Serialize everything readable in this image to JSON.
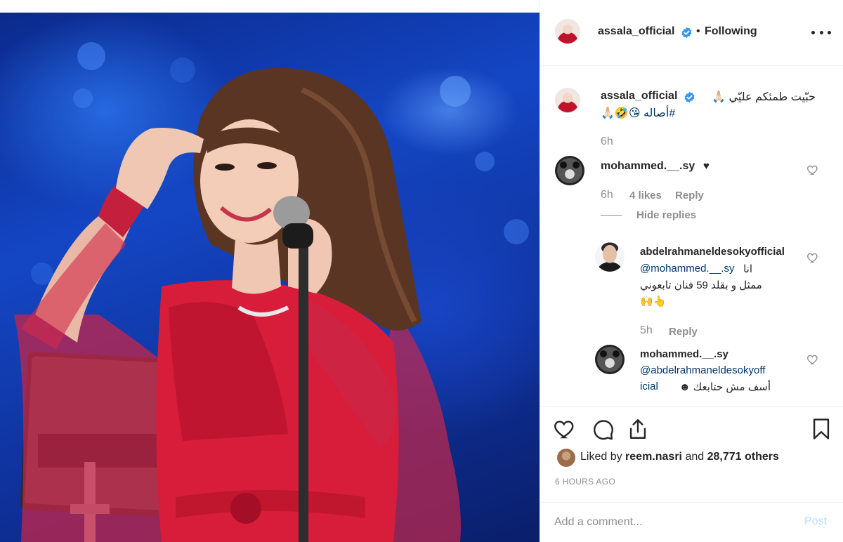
{
  "post": {
    "username": "assala_official",
    "separator": "•",
    "follow_status": "Following",
    "more_icon": "more-horizontal-icon",
    "verified_icon": "verified-badge-icon"
  },
  "caption": {
    "username": "assala_official",
    "text": "حبّيت طمئكم عليّي 🙏🏻",
    "hashtag": "#أصاله 😘🤣🙏🏻",
    "time": "6h"
  },
  "comments": [
    {
      "username": "mohammed.__.sy",
      "text": "♥",
      "time": "6h",
      "likes": "4 likes",
      "reply_label": "Reply",
      "hide_replies_label": "Hide replies",
      "replies": [
        {
          "username": "abdelrahmaneldesokyofficial",
          "mention": "@mohammed.__.sy",
          "line1": "انا",
          "line2": "ممثل و بقلد 59 فنان تابعوني",
          "line3": "🙌👆",
          "time": "5h",
          "reply_label": "Reply"
        },
        {
          "username": "mohammed.__.sy",
          "mention_part1": "@abdelrahmaneldesokyoff",
          "mention_part2": "icial",
          "text": "أسف مش حتابعك ☻"
        }
      ]
    }
  ],
  "actions": {
    "like_icon": "heart-icon",
    "comment_icon": "comment-icon",
    "share_icon": "share-icon",
    "save_icon": "bookmark-icon"
  },
  "likes": {
    "prefix": "Liked by",
    "user": "reem.nasri",
    "middle": "and",
    "others": "28,771 others"
  },
  "time_ago": "6 HOURS AGO",
  "add_comment": {
    "placeholder": "Add a comment...",
    "post_label": "Post"
  }
}
